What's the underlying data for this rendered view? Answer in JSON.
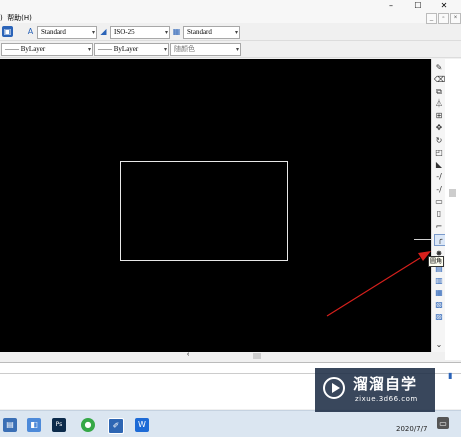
{
  "menubar": {
    "help_label": "帮助(H)",
    "paren": ")"
  },
  "window": {
    "min": "–",
    "max": "☐",
    "close": "✕"
  },
  "toolbar1": {
    "text_style": "Standard",
    "dim_style": "ISO-25",
    "table_style": "Standard"
  },
  "toolbar2": {
    "linetype": "—— ByLayer",
    "lineweight": "—— ByLayer",
    "color": "随颜色"
  },
  "tooltip": {
    "text": "圆角"
  },
  "watermark": {
    "brand": "溜溜自学",
    "site": "zixue.3d66.com"
  },
  "taskbar": {
    "date": "2020/7/7"
  },
  "colors": {
    "canvas": "#000000",
    "arrow": "#d6201c",
    "rect_line": "#e8e8e8"
  },
  "icons": [
    "layer-icon",
    "text-style-icon",
    "dimension-icon",
    "table-icon",
    "pencil-icon",
    "hatch-icon",
    "move-icon",
    "rotate-icon",
    "fillet-icon"
  ]
}
